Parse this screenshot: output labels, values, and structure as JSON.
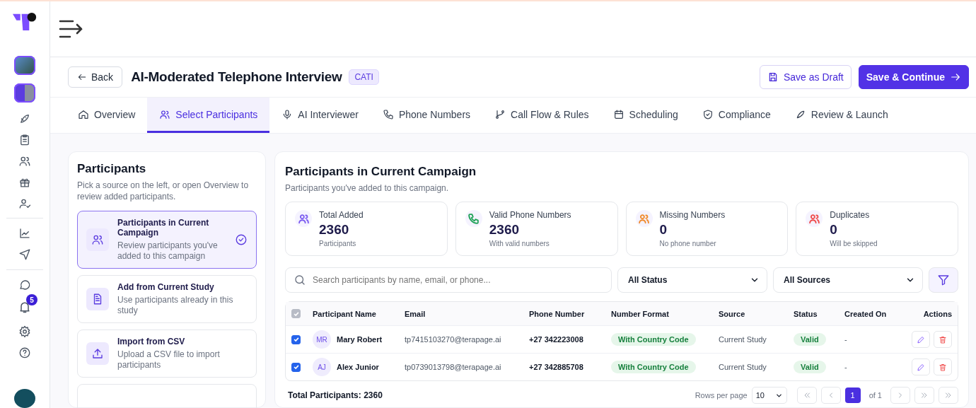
{
  "sidebar": {
    "notification_count": "5"
  },
  "header": {
    "back": "Back",
    "title": "AI-Moderated Telephone Interview",
    "badge": "CATI",
    "buttons": [
      {
        "label": "Save as Draft",
        "kind": "secondary"
      },
      {
        "label": "Save & Continue",
        "kind": "primary"
      }
    ]
  },
  "tabs": [
    {
      "label": "Overview",
      "selected": false
    },
    {
      "label": "Select Participants",
      "selected": true
    },
    {
      "label": "AI Interviewer",
      "selected": false
    },
    {
      "label": "Phone Numbers",
      "selected": false
    },
    {
      "label": "Call Flow & Rules",
      "selected": false
    },
    {
      "label": "Scheduling",
      "selected": false
    },
    {
      "label": "Compliance",
      "selected": false
    },
    {
      "label": "Review & Launch",
      "selected": false
    }
  ],
  "sources": {
    "title": "Participants",
    "description": "Pick a source on the left, or open Overview to review added participants.",
    "items": [
      {
        "title": "Participants in Current Campaign",
        "description": "Review participants you've added to this campaign",
        "selected": true
      },
      {
        "title": "Add from Current Study",
        "description": "Use participants already in this study",
        "selected": false
      },
      {
        "title": "Import from CSV",
        "description": "Upload a CSV file to import participants",
        "selected": false
      }
    ]
  },
  "campaign": {
    "title": "Participants in Current Campaign",
    "subtitle": "Participants you've added to this campaign.",
    "stats": [
      {
        "label": "Total Added",
        "value": "2360",
        "caption": "Participants",
        "color": "#7c5cf0"
      },
      {
        "label": "Valid Phone Numbers",
        "value": "2360",
        "caption": "With valid numbers",
        "color": "#22a35a"
      },
      {
        "label": "Missing Numbers",
        "value": "0",
        "caption": "No phone number",
        "color": "#f08a2c"
      },
      {
        "label": "Duplicates",
        "value": "0",
        "caption": "Will be skipped",
        "color": "#ef4b4b"
      }
    ],
    "search": {
      "placeholder": "Search participants by name, email, or phone..."
    },
    "filters": [
      "All Status",
      "All Sources"
    ],
    "table": {
      "select_all_checked": true,
      "columns": [
        "Participant Name",
        "Email",
        "Phone Number",
        "Number Format",
        "Source",
        "Status",
        "Created On",
        "Actions"
      ],
      "rows": [
        {
          "checked": true,
          "initials": "MR",
          "name": "Mary Robert",
          "email": "tp7415103270@terapage.ai",
          "phone": "+27 342223008",
          "format": "With Country Code",
          "source": "Current Study",
          "status": "Valid",
          "created": "-"
        },
        {
          "checked": true,
          "initials": "AJ",
          "name": "Alex Junior",
          "email": "tp0739013798@terapage.ai",
          "phone": "+27 342885708",
          "format": "With Country Code",
          "source": "Current Study",
          "status": "Valid",
          "created": "-"
        }
      ]
    },
    "footer": {
      "total": "Total Participants: 2360",
      "rows_label": "Rows per page",
      "rows_value": "10",
      "pages": [
        {
          "label": "1",
          "selected": true
        }
      ],
      "of": "of 1"
    }
  }
}
